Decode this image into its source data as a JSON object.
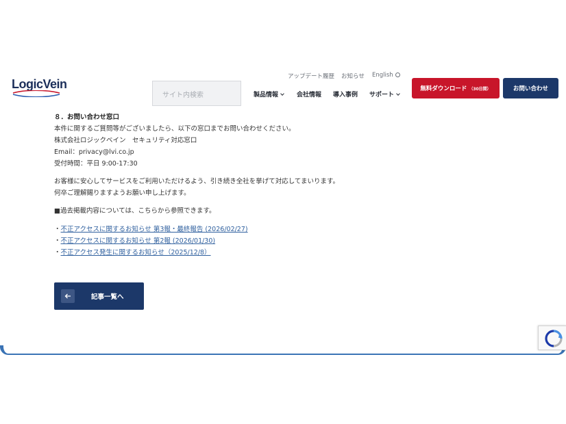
{
  "header": {
    "logo_text": "LogicVein",
    "search_placeholder": "サイト内検索",
    "utility_links": [
      "アップデート履歴",
      "お知らせ",
      "English"
    ],
    "nav_items": [
      {
        "label": "製品情報",
        "has_dropdown": true
      },
      {
        "label": "会社情報",
        "has_dropdown": false
      },
      {
        "label": "導入事例",
        "has_dropdown": false
      },
      {
        "label": "サポート",
        "has_dropdown": true
      }
    ],
    "download_button": {
      "label": "無料ダウンロード",
      "sub_label": "（30日間）"
    },
    "contact_button": {
      "label": "お問い合わせ"
    }
  },
  "article": {
    "section_heading": "８．お問い合わせ窓口",
    "contact_lines": [
      "本件に関するご質問等がございましたら、以下の窓口までお問い合わせください。",
      "株式会社ロジックベイン　セキュリティ対応窓口",
      "Email：privacy@lvi.co.jp",
      "受付時間：平日 9:00-17:30"
    ],
    "closing_lines": [
      "お客様に安心してサービスをご利用いただけるよう、引き続き全社を挙げて対応してまいります。",
      "何卒ご理解賜りますようお願い申し上げます。"
    ],
    "past_notice_intro": "■過去掲載内容については、こちらから参照できます。",
    "past_notice_links": [
      "不正アクセスに関するお知らせ 第3報・最終報告 (2026/02/27)",
      "不正アクセスに関するお知らせ 第2報 (2026/01/30)",
      "不正アクセス発生に関するお知らせ（2025/12/8）"
    ],
    "bullet_char": "・"
  },
  "back_button": {
    "label": "記事一覧へ",
    "icon": "arrow-left-icon"
  },
  "colors": {
    "brand_navy": "#1c3869",
    "download_red": "#c8152a",
    "link_blue": "#2e5f9e",
    "logo_red": "#c8152a",
    "logo_blue": "#2a5db0"
  }
}
